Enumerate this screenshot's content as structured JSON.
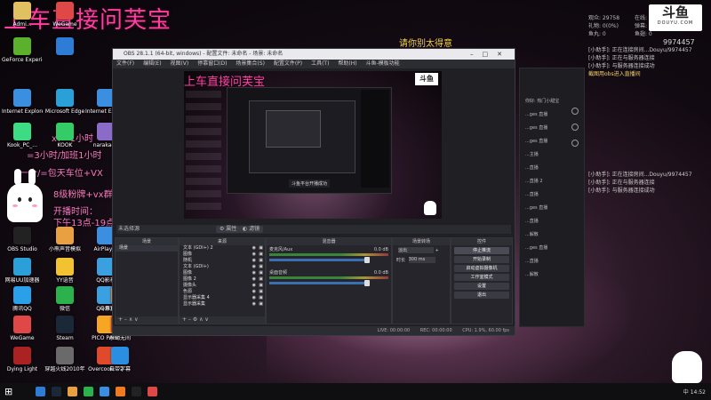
{
  "overlay": {
    "title": "上车直接问芙宝",
    "lines": [
      "x7=1小时",
      "=3小时/加班1小时",
      "一个/=包天车位+VX",
      "8级粉牌+vx群",
      "开播时间：",
      "下午13点-19点"
    ],
    "gold_text": "请你别太得意"
  },
  "stats": {
    "r1": [
      "观众: 29758",
      "在线: 8814"
    ],
    "r2": [
      "礼物: 0(0%)",
      "弹幕: 0"
    ],
    "r3": [
      "鱼丸: 0",
      "鱼翅: 0"
    ]
  },
  "douyu": {
    "logo": "斗鱼",
    "sub": "DOUYU.COM",
    "room_id": "9974457"
  },
  "top_chat": [
    "[小助手]: 正在连接房间...Douyu/9974457",
    "[小助手]: 正在与服务器连接",
    "[小助手]: 与服务器连接成功"
  ],
  "top_chat_highlight": "截图用obs进入直播间",
  "mid_chat": [
    "[小助手]: 正在连接房间...Douyu/9974457",
    "[小助手]: 正在与服务器连接",
    "[小助手]: 与服务器连接成功"
  ],
  "desktop_icons": [
    {
      "label": "Admi...",
      "color": "#e0c060"
    },
    {
      "label": "GeForce Experience",
      "color": "#5bb02c"
    },
    {
      "label": "",
      "color": "#2d7cd6"
    },
    {
      "label": "Internet Explorer",
      "color": "#3a8fe0"
    },
    {
      "label": "Kook_PC_...",
      "color": "#3ddc84"
    },
    {
      "label": "WeGame",
      "color": "#e04848"
    },
    {
      "label": "Microsoft Edge",
      "color": "#2aa0d8"
    },
    {
      "label": "KOOK",
      "color": "#33cc66"
    },
    {
      "label": "Internet Explorer",
      "color": "#3a8fe0"
    },
    {
      "label": "naraka-...",
      "color": "#8a6cc8"
    },
    {
      "label": "OBS Studio",
      "color": "#222"
    },
    {
      "label": "小熊声音模拟",
      "color": "#e8a040"
    },
    {
      "label": "AirPlayer",
      "color": "#3a8fe0"
    },
    {
      "label": "网易UU加速器",
      "color": "#2a9fd8"
    },
    {
      "label": "YY语音",
      "color": "#f2c230"
    },
    {
      "label": "QQ影视",
      "color": "#3aa0e0"
    },
    {
      "label": "腾讯QQ",
      "color": "#2aa0e8"
    },
    {
      "label": "微信",
      "color": "#2bb24c"
    },
    {
      "label": "QQ游戏",
      "color": "#3aa0e0"
    },
    {
      "label": "斗鱼直播伴侣平台",
      "color": "#f07a20"
    },
    {
      "label": "WeGame",
      "color": "#e04848"
    },
    {
      "label": "Steam",
      "color": "#1b2838"
    },
    {
      "label": "PICO PARK",
      "color": "#f6a623"
    },
    {
      "label": "永劫无间",
      "color": "#b03030"
    },
    {
      "label": "Dying Light",
      "color": "#aa2222"
    },
    {
      "label": "穿越火线2010年",
      "color": "#6a6a6a"
    },
    {
      "label": "Overcook... 2",
      "color": "#e04a2a"
    },
    {
      "label": "自带字幕",
      "color": "#2a8fe0"
    }
  ],
  "obs": {
    "title": "OBS 28.1.1 (64-bit, windows) - 配置文件: 未命名 - 场景: 未命名",
    "menu": [
      "文件(F)",
      "编辑(E)",
      "视图(V)",
      "停靠窗口(D)",
      "场景集合(S)",
      "配置文件(P)",
      "工具(T)",
      "帮助(H)",
      "斗鱼-模板功能"
    ],
    "scene_bar_label": "未选择源",
    "scene_bar_props": "属性",
    "scene_bar_filters": "滤镜",
    "scenes_header": "场景",
    "scenes": [
      "场景"
    ],
    "sources_header": "来源",
    "sources": [
      "文本 (GDI+) 2",
      "图像",
      "随机",
      "文本 (GDI+)",
      "图像",
      "图像 2",
      "摄像头",
      "色源",
      "显示器采集 4",
      "显示器采集"
    ],
    "mixer_header": "混音器",
    "mixer": [
      {
        "name": "麦克风/Aux",
        "db": "0.0 dB"
      },
      {
        "name": "桌面音频",
        "db": "0.0 dB"
      }
    ],
    "transitions_header": "场景转场",
    "transition_type": "淡出",
    "transition_duration_label": "时长",
    "transition_duration": "300 ms",
    "controls_header": "控件",
    "controls": [
      "停止推流",
      "开始录制",
      "启动虚拟摄像机",
      "工作室模式",
      "设置",
      "退出"
    ],
    "status": [
      "LIVE: 00:00:00",
      "REC: 00:00:00",
      "CPU: 1.9%, 60.00 fps"
    ],
    "preview_notice": "斗鱼平台开播成功"
  },
  "chat_window": {
    "items": [
      "你好: 热门小甜宝",
      "...ges 直播",
      "...ges 直播",
      "...ges 直播",
      "...主播",
      "...直播",
      "...直播 2",
      "...直播",
      "...ges 直播",
      "...直播",
      "...解散",
      "...ges 直播",
      "...直播",
      "...解散"
    ]
  },
  "taskbar": {
    "start": "⊞",
    "tray_time": "14:52",
    "tray_lang": "中",
    "icons": [
      "#2d7cd6",
      "#1b2838",
      "#e8a040",
      "#2bb24c",
      "#3a8fe0",
      "#f07a20",
      "#222",
      "#e04848"
    ]
  }
}
